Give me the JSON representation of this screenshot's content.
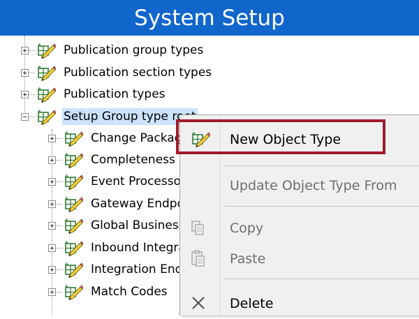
{
  "window": {
    "title": "System Setup"
  },
  "tree": {
    "items": [
      {
        "label": "Publication group types",
        "icon": "object-type-icon",
        "expanded": false
      },
      {
        "label": "Publication section types",
        "icon": "object-type-icon",
        "expanded": false
      },
      {
        "label": "Publication types",
        "icon": "object-type-icon",
        "expanded": false
      },
      {
        "label": "Setup Group type root",
        "icon": "object-type-icon",
        "expanded": true,
        "selected": true,
        "children": [
          {
            "label": "Change Packages"
          },
          {
            "label": "Completeness"
          },
          {
            "label": "Event Processors"
          },
          {
            "label": "Gateway Endpoints"
          },
          {
            "label": "Global Business Rules"
          },
          {
            "label": "Inbound Integration"
          },
          {
            "label": "Integration Endpoints"
          },
          {
            "label": "Match Codes"
          }
        ]
      }
    ]
  },
  "context_menu": {
    "items": [
      {
        "label": "New Object Type",
        "icon": "object-type-icon",
        "enabled": true,
        "highlighted": true
      },
      {
        "label": "Update Object Type From",
        "icon": "",
        "enabled": false
      },
      {
        "label": "Copy",
        "icon": "copy-icon",
        "enabled": false
      },
      {
        "label": "Paste",
        "icon": "paste-icon",
        "enabled": false
      },
      {
        "label": "Delete",
        "icon": "delete-icon",
        "enabled": true
      }
    ]
  },
  "colors": {
    "title_bar": "#1166cc",
    "selection": "#cce3fb",
    "menu_background": "#f0f0f0",
    "highlight_border": "#a01c2c"
  }
}
